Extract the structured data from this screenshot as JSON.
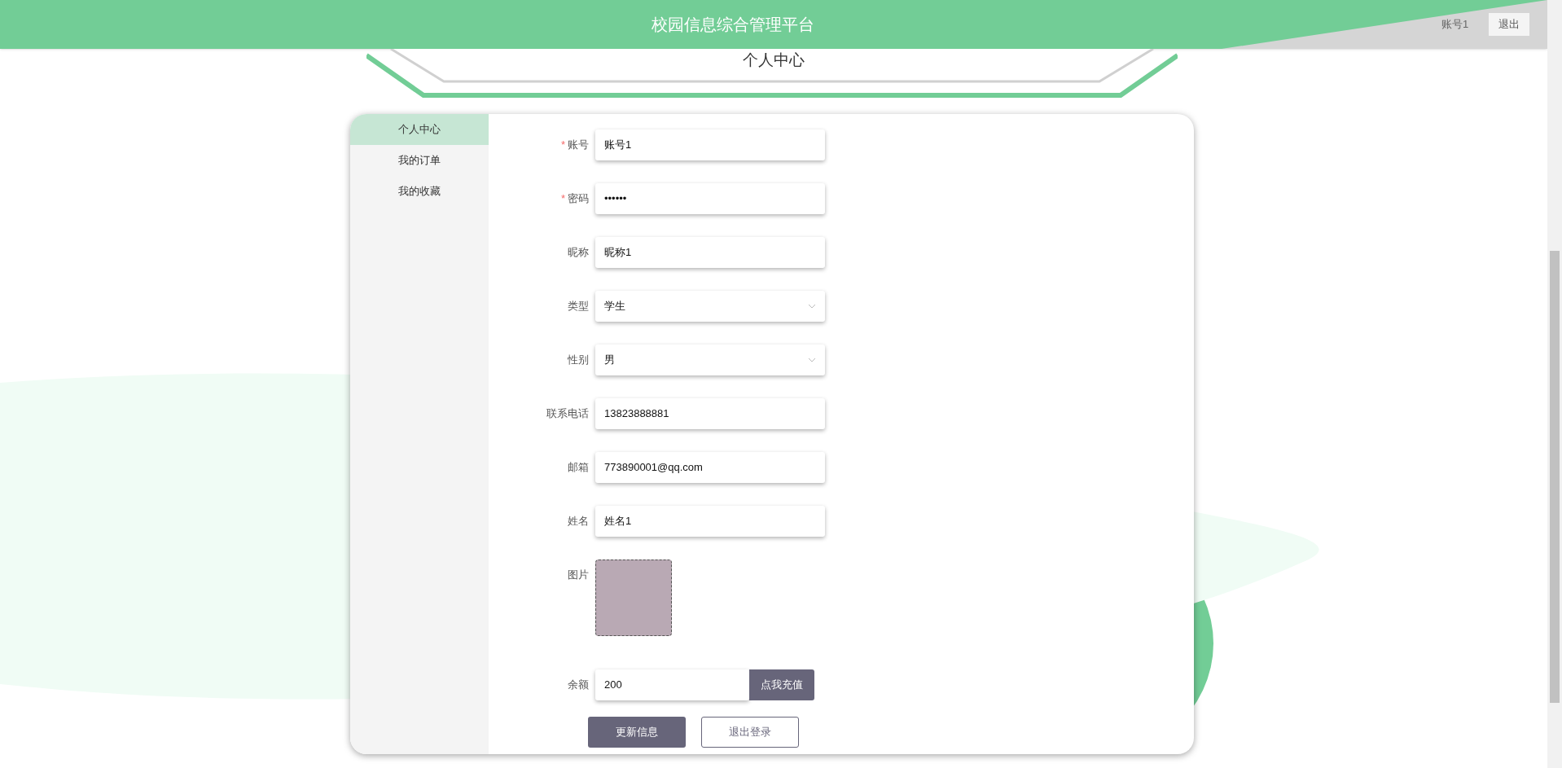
{
  "header": {
    "title": "校园信息综合管理平台",
    "user": "账号1",
    "logout": "退出"
  },
  "banner": {
    "title": "个人中心"
  },
  "sidebar": {
    "items": [
      {
        "label": "个人中心",
        "selected": true
      },
      {
        "label": "我的订单",
        "selected": false
      },
      {
        "label": "我的收藏",
        "selected": false
      }
    ]
  },
  "form": {
    "fields": [
      {
        "kind": "text",
        "label": "账号",
        "required_mark": "*",
        "value": "账号1"
      },
      {
        "kind": "password",
        "label": "密码",
        "required_mark": "*",
        "value": "••••••"
      },
      {
        "kind": "text",
        "label": "昵称",
        "value": "昵称1"
      },
      {
        "kind": "select",
        "label": "类型",
        "value": "学生"
      },
      {
        "kind": "select",
        "label": "性别",
        "value": "男"
      },
      {
        "kind": "text",
        "label": "联系电话",
        "value": "13823888881"
      },
      {
        "kind": "text",
        "label": "邮箱",
        "value": "773890001@qq.com"
      },
      {
        "kind": "text",
        "label": "姓名",
        "value": "姓名1"
      },
      {
        "kind": "image",
        "label": "图片"
      },
      {
        "kind": "balance",
        "label": "余额",
        "value": "200",
        "action": "点我充值"
      }
    ],
    "buttons": [
      {
        "kind": "primary",
        "label": "更新信息"
      },
      {
        "kind": "outline",
        "label": "退出登录"
      }
    ]
  }
}
